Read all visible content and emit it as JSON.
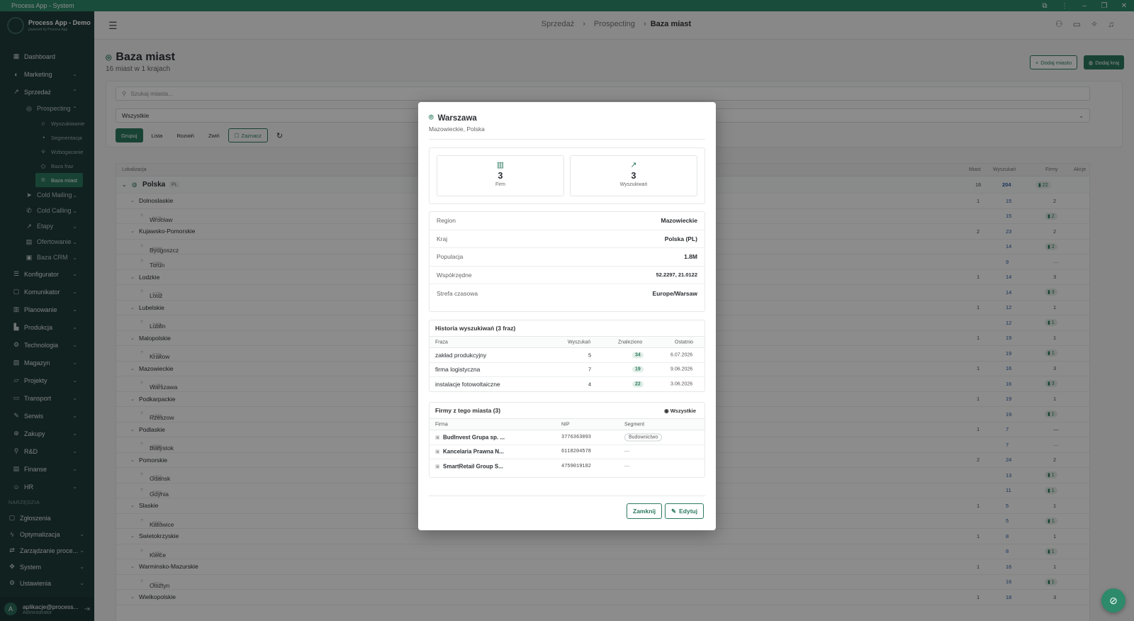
{
  "window": {
    "title": "Process App - System"
  },
  "brand": {
    "name": "Process App - Demo",
    "tagline": "powered by Process App"
  },
  "sidebar": {
    "items": [
      {
        "label": "Dashboard",
        "icon": "grid-icon"
      },
      {
        "label": "Marketing",
        "icon": "megaphone-icon"
      },
      {
        "label": "Sprzedaż",
        "icon": "trending-icon"
      },
      {
        "label": "Prospecting",
        "icon": "target-icon"
      },
      {
        "label": "Wyszukiwanie",
        "icon": "search-icon"
      },
      {
        "label": "Segmentacja",
        "icon": "segment-icon"
      },
      {
        "label": "Wzbogacanie",
        "icon": "sparkle-icon"
      },
      {
        "label": "Baza fraz",
        "icon": "tag-icon"
      },
      {
        "label": "Baza miast",
        "icon": "pin-icon"
      },
      {
        "label": "Cold Mailing",
        "icon": "send-icon"
      },
      {
        "label": "Cold Calling",
        "icon": "phone-icon"
      },
      {
        "label": "Etapy",
        "icon": "stages-icon"
      },
      {
        "label": "Ofertowanie",
        "icon": "document-icon"
      },
      {
        "label": "Baza CRM",
        "icon": "database-icon"
      },
      {
        "label": "Konfigurator",
        "icon": "sliders-icon"
      },
      {
        "label": "Komunikator",
        "icon": "chat-icon"
      },
      {
        "label": "Planowanie",
        "icon": "calendar-icon"
      },
      {
        "label": "Produkcja",
        "icon": "factory-icon"
      },
      {
        "label": "Technologia",
        "icon": "cpu-icon"
      },
      {
        "label": "Magazyn",
        "icon": "box-icon"
      },
      {
        "label": "Projekty",
        "icon": "folder-icon"
      },
      {
        "label": "Transport",
        "icon": "truck-icon"
      },
      {
        "label": "Serwis",
        "icon": "wrench-icon"
      },
      {
        "label": "Zakupy",
        "icon": "cart-icon"
      },
      {
        "label": "R&D",
        "icon": "flask-icon"
      },
      {
        "label": "Finanse",
        "icon": "wallet-icon"
      },
      {
        "label": "HR",
        "icon": "people-icon"
      }
    ],
    "section_tools": "NARZĘDZIA",
    "tools": [
      {
        "label": "Zgłoszenia"
      },
      {
        "label": "Optymalizacja"
      },
      {
        "label": "Zarządzanie proce..."
      },
      {
        "label": "System"
      },
      {
        "label": "Ustawienia"
      }
    ],
    "user": {
      "email": "aplikacje@process...",
      "role": "Administrator",
      "initial": "A"
    }
  },
  "breadcrumb": {
    "items": [
      "Sprzedaż",
      "Prospecting"
    ],
    "current": "Baza miast"
  },
  "page": {
    "title": "Baza miast",
    "subtitle": "16 miast w 1 krajach",
    "add_city": "Dodaj miasto",
    "add_country": "Dodaj kraj",
    "search_placeholder": "Szukaj miasta...",
    "filter_value": "Wszystkie",
    "toolbar": {
      "group": "Grupuj",
      "list": "Lista",
      "expand": "Rozwiń",
      "collapse": "Zwiń",
      "select": "Zaznacz"
    }
  },
  "table": {
    "headers": {
      "location": "Lokalizacja",
      "cities": "Miast",
      "searches": "Wyszukań",
      "firms": "Firmy",
      "actions": "Akcje"
    },
    "country": {
      "name": "Polska",
      "code": "PL",
      "cities": "16",
      "searches": "204",
      "firms": "22"
    },
    "rows": [
      {
        "type": "region",
        "name": "Dolnoslaskie",
        "cities": "1",
        "searches": "15",
        "firms": "2"
      },
      {
        "type": "city",
        "name": "Wrocław",
        "pop": "642k",
        "searches": "15",
        "firms": "2"
      },
      {
        "type": "region",
        "name": "Kujawsko-Pomorskie",
        "cities": "2",
        "searches": "23",
        "firms": "2"
      },
      {
        "type": "city",
        "name": "Bydgoszcz",
        "pop": "344k",
        "searches": "14",
        "firms": "2"
      },
      {
        "type": "city",
        "name": "Torun",
        "pop": "199k",
        "searches": "9",
        "firms": "—"
      },
      {
        "type": "region",
        "name": "Lodzkie",
        "cities": "1",
        "searches": "14",
        "firms": "3"
      },
      {
        "type": "city",
        "name": "Lodz",
        "pop": "677k",
        "searches": "14",
        "firms": "3"
      },
      {
        "type": "region",
        "name": "Lubelskie",
        "cities": "1",
        "searches": "12",
        "firms": "1"
      },
      {
        "type": "city",
        "name": "Lublin",
        "pop": "340k",
        "searches": "12",
        "firms": "1"
      },
      {
        "type": "region",
        "name": "Malopolskie",
        "cities": "1",
        "searches": "19",
        "firms": "1"
      },
      {
        "type": "city",
        "name": "Krakow",
        "pop": "779k",
        "searches": "19",
        "firms": "1"
      },
      {
        "type": "region",
        "name": "Mazowieckie",
        "cities": "1",
        "searches": "16",
        "firms": "3"
      },
      {
        "type": "city",
        "name": "Warszawa",
        "pop": "1.8M",
        "searches": "16",
        "firms": "3"
      },
      {
        "type": "region",
        "name": "Podkarpackie",
        "cities": "1",
        "searches": "19",
        "firms": "1"
      },
      {
        "type": "city",
        "name": "Rzeszow",
        "pop": "196k",
        "searches": "19",
        "firms": "1"
      },
      {
        "type": "region",
        "name": "Podlaskie",
        "cities": "1",
        "searches": "7",
        "firms": "—"
      },
      {
        "type": "city",
        "name": "Bialystok",
        "pop": "298k",
        "searches": "7",
        "firms": "—"
      },
      {
        "type": "region",
        "name": "Pomorskie",
        "cities": "2",
        "searches": "24",
        "firms": "2"
      },
      {
        "type": "city",
        "name": "Gdansk",
        "pop": "471k",
        "searches": "13",
        "firms": "1"
      },
      {
        "type": "city",
        "name": "Gdynia",
        "pop": "246k",
        "searches": "11",
        "firms": "1"
      },
      {
        "type": "region",
        "name": "Slaskie",
        "cities": "1",
        "searches": "5",
        "firms": "1"
      },
      {
        "type": "city",
        "name": "Katowice",
        "pop": "293k",
        "searches": "5",
        "firms": "1"
      },
      {
        "type": "region",
        "name": "Swietokrzyskie",
        "cities": "1",
        "searches": "8",
        "firms": "1"
      },
      {
        "type": "city",
        "name": "Kielce",
        "pop": "195k",
        "searches": "8",
        "firms": "1"
      },
      {
        "type": "region",
        "name": "Warminsko-Mazurskie",
        "cities": "1",
        "searches": "16",
        "firms": "1"
      },
      {
        "type": "city",
        "name": "Olsztyn",
        "pop": "171k",
        "searches": "16",
        "firms": "1"
      },
      {
        "type": "region",
        "name": "Wielkopolskie",
        "cities": "1",
        "searches": "18",
        "firms": "3"
      }
    ]
  },
  "modal": {
    "title": "Warszawa",
    "subtitle": "Mazowieckie, Polska",
    "stats": [
      {
        "value": "3",
        "label": "Firm",
        "icon": "building-icon"
      },
      {
        "value": "3",
        "label": "Wyszukiwań",
        "icon": "trend-icon"
      }
    ],
    "info": [
      {
        "key": "Region",
        "value": "Mazowieckie"
      },
      {
        "key": "Kraj",
        "value": "Polska (PL)"
      },
      {
        "key": "Populacja",
        "value": "1.8M"
      },
      {
        "key": "Współrzędne",
        "value": "52.2297, 21.0122"
      },
      {
        "key": "Strefa czasowa",
        "value": "Europe/Warsaw"
      }
    ],
    "history": {
      "title": "Historia wyszukiwań (3 fraz)",
      "headers": {
        "phrase": "Fraza",
        "searches": "Wyszukań",
        "found": "Znaleziono",
        "last": "Ostatnio"
      },
      "rows": [
        {
          "phrase": "zakład produkcyjny",
          "searches": "5",
          "found": "34",
          "last": "6.07.2026"
        },
        {
          "phrase": "firma logistyczna",
          "searches": "7",
          "found": "19",
          "last": "9.06.2026"
        },
        {
          "phrase": "instalacje fotowoltaiczne",
          "searches": "4",
          "found": "22",
          "last": "3.06.2026"
        }
      ]
    },
    "firms": {
      "title": "Firmy z tego miasta (3)",
      "all": "Wszystkie",
      "headers": {
        "firm": "Firma",
        "nip": "NIP",
        "segment": "Segment"
      },
      "rows": [
        {
          "name": "BudInvest Grupa sp. ...",
          "nip": "3776363093",
          "segment": "Budownictwo"
        },
        {
          "name": "Kancelaria Prawna N...",
          "nip": "6118204578",
          "segment": "—"
        },
        {
          "name": "SmartRetail Group S...",
          "nip": "4759019182",
          "segment": "—"
        }
      ]
    },
    "close": "Zamknij",
    "edit": "Edytuj"
  },
  "colors": {
    "accent": "#2d7a5f",
    "sidebar": "#1f3d3b",
    "titlebar": "#2f8a6a",
    "link": "#2d5fa5"
  }
}
